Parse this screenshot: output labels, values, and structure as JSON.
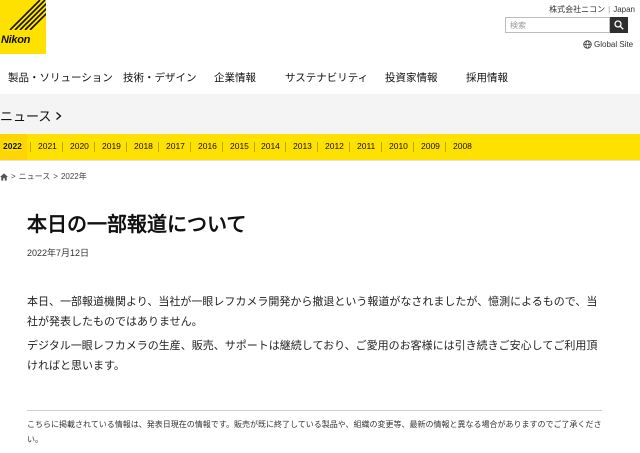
{
  "header": {
    "logo_text": "Nikon",
    "corp_name": "株式会社ニコン",
    "region": "Japan",
    "search_placeholder": "検索",
    "global_site": "Global Site"
  },
  "nav": {
    "items": [
      "製品・ソリューション",
      "技術・デザイン",
      "企業情報",
      "サステナビリティ",
      "投資家情報",
      "採用情報"
    ]
  },
  "section": {
    "title": "ニュース"
  },
  "years": {
    "active": "2022",
    "items": [
      "2022",
      "2021",
      "2020",
      "2019",
      "2018",
      "2017",
      "2016",
      "2015",
      "2014",
      "2013",
      "2012",
      "2011",
      "2010",
      "2009",
      "2008"
    ]
  },
  "breadcrumb": {
    "items": [
      "ニュース",
      "2022年"
    ]
  },
  "article": {
    "title": "本日の一部報道について",
    "date": "2022年7月12日",
    "paragraph1": "本日、一部報道機関より、当社が一眼レフカメラ開発から撤退という報道がなされましたが、憶測によるもので、当社が発表したものではありません。",
    "paragraph2": "デジタル一眼レフカメラの生産、販売、サポートは継続しており、ご愛用のお客様には引き続きご安心してご利用頂ければと思います。"
  },
  "disclaimer": "こちらに掲載されている情報は、発表日現在の情報です。販売が既に終了している製品や、組織の変更等、最新の情報と異なる場合がありますのでご了承ください。",
  "colors": {
    "brand_yellow": "#ffe100",
    "text": "#222222"
  }
}
